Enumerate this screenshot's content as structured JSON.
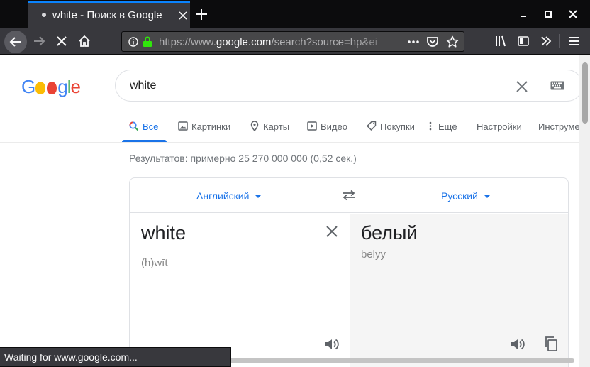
{
  "browser": {
    "tab": {
      "title": "white - Поиск в Google"
    },
    "url": {
      "scheme": "https://www.",
      "domain": "google.com",
      "rest": "/search?source=hp&ei"
    },
    "status_text": "Waiting for www.google.com..."
  },
  "google": {
    "logo_letters": [
      "G",
      "o",
      "o",
      "g",
      "l",
      "e"
    ],
    "search": {
      "value": "white"
    },
    "tabs": [
      {
        "label": "Все",
        "icon": "search-icon",
        "active": true
      },
      {
        "label": "Картинки",
        "icon": "image-icon"
      },
      {
        "label": "Карты",
        "icon": "map-pin-icon"
      },
      {
        "label": "Видео",
        "icon": "play-icon"
      },
      {
        "label": "Покупки",
        "icon": "tag-icon"
      },
      {
        "label": "Ещё",
        "icon": "more-vert-icon"
      },
      {
        "label": "Настройки"
      },
      {
        "label": "Инструме"
      }
    ],
    "result_stats": "Результатов: примерно 25 270 000 000 (0,52 сек.)",
    "translate": {
      "source_lang": "Английский",
      "target_lang": "Русский",
      "source_text": "white",
      "source_translit": "(h)wīt",
      "target_text": "белый",
      "target_translit": "belyy"
    }
  },
  "colors": {
    "accent": "#1a73e8",
    "chrome_dark": "#38383d",
    "tab_highlight": "#0a84ff"
  }
}
